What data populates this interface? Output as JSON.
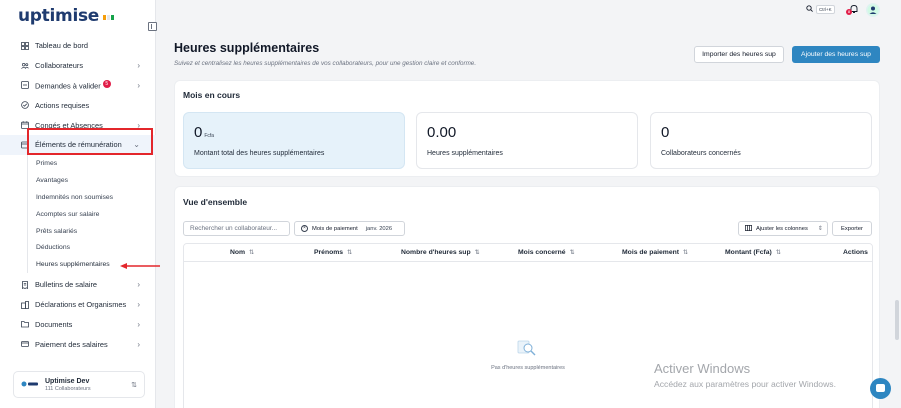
{
  "brand": {
    "logo_text": "uptimise",
    "flag_colors": [
      "#f59e0b",
      "#ffffff",
      "#16a34a"
    ]
  },
  "sidebar": {
    "items": [
      {
        "label": "Tableau de bord",
        "icon": "dashboard-icon"
      },
      {
        "label": "Collaborateurs",
        "icon": "users-icon",
        "chevron": "›"
      },
      {
        "label": "Demandes à valider",
        "icon": "inbox-icon",
        "badge": "5",
        "chevron": "›"
      },
      {
        "label": "Actions requises",
        "icon": "check-circle-icon"
      },
      {
        "label": "Congés et Absences",
        "icon": "calendar-icon",
        "chevron": "›"
      },
      {
        "label": "Éléments de rémunération",
        "icon": "wallet-icon",
        "chevron": "⌄"
      }
    ],
    "subitems": [
      "Primes",
      "Avantages",
      "Indemnités non soumises",
      "Acomptes sur salaire",
      "Prêts salariés",
      "Déductions",
      "Heures supplémentaires"
    ],
    "items2": [
      {
        "label": "Bulletins de salaire",
        "icon": "receipt-icon",
        "chevron": "›"
      },
      {
        "label": "Déclarations et Organismes",
        "icon": "building-icon",
        "chevron": "›"
      },
      {
        "label": "Documents",
        "icon": "folder-icon",
        "chevron": "›"
      },
      {
        "label": "Paiement des salaires",
        "icon": "card-icon",
        "chevron": "›"
      }
    ],
    "org": {
      "name": "Uptimise Dev",
      "count": "111 Collaborateurs"
    }
  },
  "topbar": {
    "shortcut": "Ctrl+K",
    "notif_count": "8"
  },
  "header": {
    "title": "Heures supplémentaires",
    "subtitle": "Suivez et centralisez les heures supplémentaires de vos collaborateurs, pour une gestion claire et conforme.",
    "import_label": "Importer des heures sup",
    "add_label": "Ajouter des heures sup"
  },
  "current_month": {
    "title": "Mois en cours",
    "stats": [
      {
        "value": "0",
        "unit": "Fcfa",
        "label": "Montant total des heures supplémentaires"
      },
      {
        "value": "0.00",
        "label": "Heures supplémentaires"
      },
      {
        "value": "0",
        "label": "Collaborateurs concernés"
      }
    ]
  },
  "overview": {
    "title": "Vue d'ensemble",
    "search_placeholder": "Rechercher un collaborateur...",
    "filter_label": "Mois de paiement",
    "filter_value": "janv. 2026",
    "columns_label": "Ajuster les colonnes",
    "export_label": "Exporter",
    "columns": [
      "Nom",
      "Prénoms",
      "Nombre d'heures sup",
      "Mois concerné",
      "Mois de paiement",
      "Montant (Fcfa)",
      "Actions"
    ],
    "empty_text": "Pas d'heures supplémentaires"
  },
  "watermark": {
    "line1": "Activer Windows",
    "line2": "Accédez aux paramètres pour activer Windows."
  },
  "colors": {
    "primary": "#2e86c1",
    "highlight": "#e3262b",
    "badge": "#e11d48"
  }
}
